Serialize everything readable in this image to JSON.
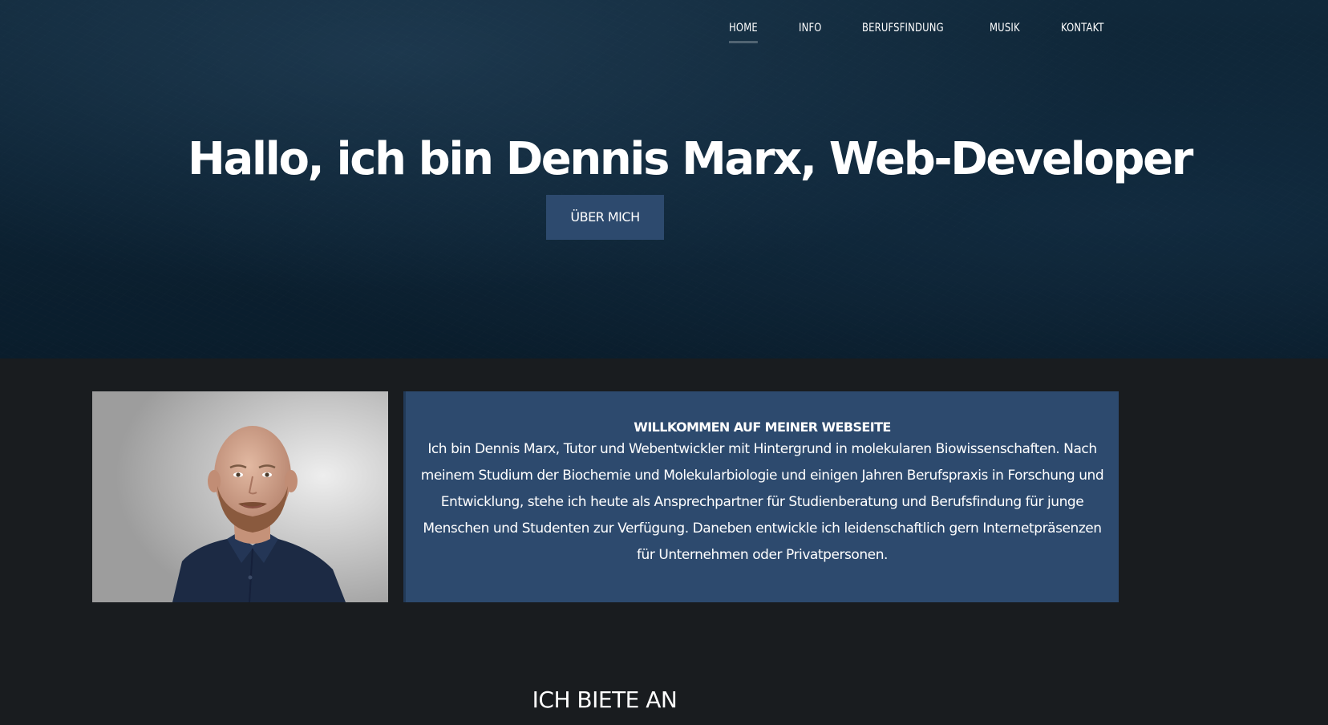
{
  "nav": {
    "items": [
      {
        "label": "HOME",
        "active": true
      },
      {
        "label": "INFO",
        "active": false
      },
      {
        "label": "BERUFSFINDUNG",
        "active": false
      },
      {
        "label": "MUSIK",
        "active": false
      },
      {
        "label": "KONTAKT",
        "active": false
      }
    ]
  },
  "hero": {
    "title": "Hallo, ich bin Dennis Marx, Web-Developer",
    "button_label": "ÜBER MICH"
  },
  "about": {
    "heading": "WILLKOMMEN AUF MEINER WEBSEITE",
    "text": "Ich bin Dennis Marx, Tutor und Webentwickler mit Hintergrund in molekularen Biowissenschaften. Nach meinem Studium der Biochemie und Molekularbiologie und einigen Jahren Berufspraxis in Forschung und Entwicklung, stehe ich heute als Ansprechpartner für Studienberatung und Berufsfindung für junge Menschen und Studenten zur Verfügung. Daneben entwickle ich leidenschaftlich gern Internetpräsenzen für Unternehmen oder Privatpersonen."
  },
  "services": {
    "title": "ICH BIETE AN"
  },
  "colors": {
    "accent": "#2d4a6e",
    "page_background": "#191c1f",
    "hero_background": "#0c2233"
  }
}
